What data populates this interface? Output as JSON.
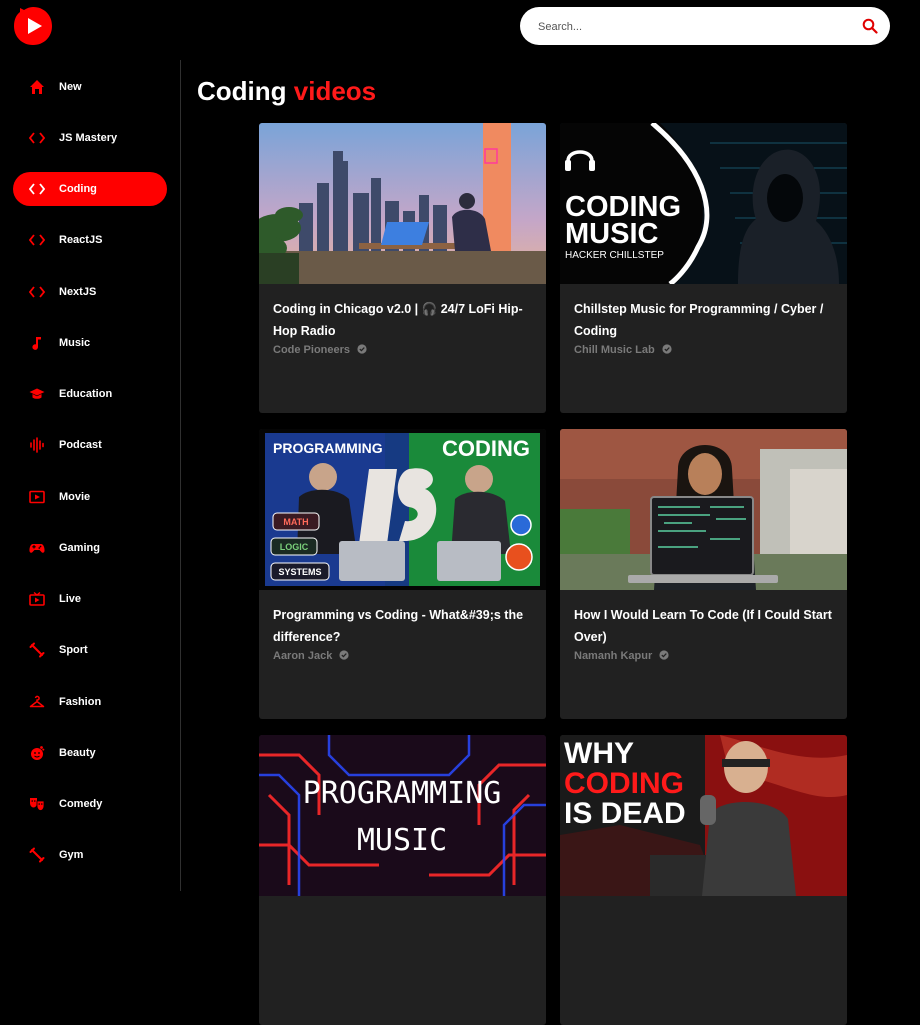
{
  "app": {
    "accent": "#ff0000"
  },
  "search": {
    "placeholder": "Search..."
  },
  "sidebar": {
    "items": [
      {
        "label": "New",
        "icon": "home-icon",
        "active": false
      },
      {
        "label": "JS Mastery",
        "icon": "code-icon",
        "active": false
      },
      {
        "label": "Coding",
        "icon": "code-icon",
        "active": true
      },
      {
        "label": "ReactJS",
        "icon": "code-icon",
        "active": false
      },
      {
        "label": "NextJS",
        "icon": "code-icon",
        "active": false
      },
      {
        "label": "Music",
        "icon": "music-note-icon",
        "active": false
      },
      {
        "label": "Education",
        "icon": "graduation-cap-icon",
        "active": false
      },
      {
        "label": "Podcast",
        "icon": "podcast-icon",
        "active": false
      },
      {
        "label": "Movie",
        "icon": "movie-icon",
        "active": false
      },
      {
        "label": "Gaming",
        "icon": "gamepad-icon",
        "active": false
      },
      {
        "label": "Live",
        "icon": "live-tv-icon",
        "active": false
      },
      {
        "label": "Sport",
        "icon": "sport-icon",
        "active": false
      },
      {
        "label": "Fashion",
        "icon": "hanger-icon",
        "active": false
      },
      {
        "label": "Beauty",
        "icon": "face-icon",
        "active": false
      },
      {
        "label": "Comedy",
        "icon": "theater-masks-icon",
        "active": false
      },
      {
        "label": "Gym",
        "icon": "dumbbell-icon",
        "active": false
      }
    ]
  },
  "main": {
    "title_prefix": "Coding",
    "title_accent": "videos",
    "videos": [
      {
        "title": "Coding in Chicago v2.0 | 🎧 24/7 LoFi Hip-Hop Radio",
        "channel": "Code Pioneers",
        "verified": true
      },
      {
        "title": "Chillstep Music for Programming / Cyber / Coding",
        "channel": "Chill Music Lab",
        "verified": true,
        "thumb_text": [
          "CODING",
          "MUSIC",
          "HACKER CHILLSTEP"
        ]
      },
      {
        "title": "Programming vs Coding - What&#39;s the difference?",
        "channel": "Aaron Jack",
        "verified": true,
        "thumb_text": [
          "PROGRAMMING",
          "CODING",
          "VS",
          "MATH",
          "LOGIC",
          "SYSTEMS"
        ]
      },
      {
        "title": "How I Would Learn To Code (If I Could Start Over)",
        "channel": "Namanh Kapur",
        "verified": true
      },
      {
        "title": "",
        "channel": "",
        "verified": false,
        "thumb_text": [
          "PROGRAMMING",
          "MUSIC"
        ]
      },
      {
        "title": "",
        "channel": "",
        "verified": false,
        "thumb_text": [
          "WHY",
          "CODING",
          "IS DEAD"
        ]
      }
    ]
  }
}
